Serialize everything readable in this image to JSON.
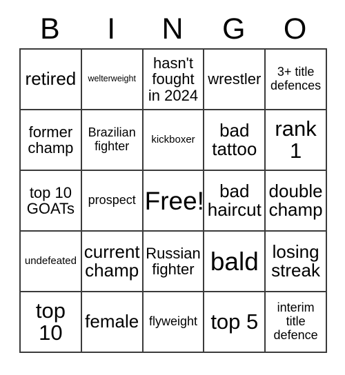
{
  "card": {
    "title": "BINGO",
    "headers": [
      "B",
      "I",
      "N",
      "G",
      "O"
    ],
    "rows": [
      [
        {
          "text": "retired",
          "size": "xl"
        },
        {
          "text": "welterweight",
          "size": "xs"
        },
        {
          "text": "hasn't fought in 2024",
          "size": "l"
        },
        {
          "text": "wrestler",
          "size": "l"
        },
        {
          "text": "3+ title defences",
          "size": "m"
        }
      ],
      [
        {
          "text": "former champ",
          "size": "l"
        },
        {
          "text": "Brazilian fighter",
          "size": "m"
        },
        {
          "text": "kickboxer",
          "size": "s"
        },
        {
          "text": "bad tattoo",
          "size": "xl"
        },
        {
          "text": "rank 1",
          "size": "xxl"
        }
      ],
      [
        {
          "text": "top 10 GOATs",
          "size": "l"
        },
        {
          "text": "prospect",
          "size": "m"
        },
        {
          "text": "Free!",
          "size": "huge"
        },
        {
          "text": "bad haircut",
          "size": "xl"
        },
        {
          "text": "double champ",
          "size": "xl"
        }
      ],
      [
        {
          "text": "undefeated",
          "size": "s"
        },
        {
          "text": "current champ",
          "size": "xl"
        },
        {
          "text": "Russian fighter",
          "size": "l"
        },
        {
          "text": "bald",
          "size": "huge"
        },
        {
          "text": "losing streak",
          "size": "xl"
        }
      ],
      [
        {
          "text": "top 10",
          "size": "xxl"
        },
        {
          "text": "female",
          "size": "xl"
        },
        {
          "text": "flyweight",
          "size": "m"
        },
        {
          "text": "top 5",
          "size": "xxl"
        },
        {
          "text": "interim title defence",
          "size": "m"
        }
      ]
    ],
    "free_space": {
      "row": 2,
      "col": 2,
      "label": "Free!"
    },
    "colors": {
      "background": "#ffffff",
      "text": "#000000",
      "border": "#3a3a3a"
    }
  }
}
